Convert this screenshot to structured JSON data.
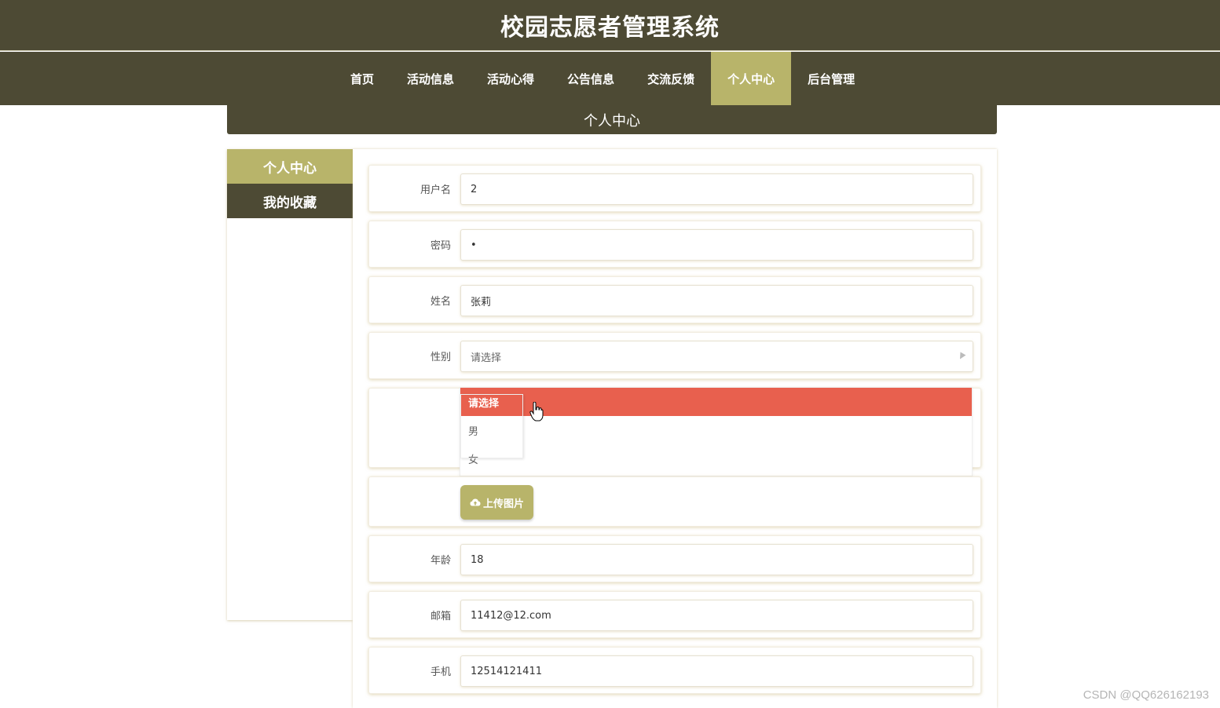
{
  "app": {
    "title": "校园志愿者管理系统"
  },
  "nav": {
    "items": [
      {
        "label": "首页",
        "active": false
      },
      {
        "label": "活动信息",
        "active": false
      },
      {
        "label": "活动心得",
        "active": false
      },
      {
        "label": "公告信息",
        "active": false
      },
      {
        "label": "交流反馈",
        "active": false
      },
      {
        "label": "个人中心",
        "active": true
      },
      {
        "label": "后台管理",
        "active": false
      }
    ]
  },
  "section": {
    "title": "个人中心"
  },
  "sidebar": {
    "items": [
      {
        "label": "个人中心",
        "active": true
      },
      {
        "label": "我的收藏",
        "active": false
      }
    ]
  },
  "form": {
    "username": {
      "label": "用户名",
      "value": "2"
    },
    "password": {
      "label": "密码",
      "value": "•"
    },
    "name": {
      "label": "姓名",
      "value": "张莉"
    },
    "gender": {
      "label": "性别",
      "value": "请选择",
      "options": [
        "请选择",
        "男",
        "女"
      ]
    },
    "upload": {
      "label": "上传图片",
      "icon": "cloud-upload-icon"
    },
    "age": {
      "label": "年龄",
      "value": "18"
    },
    "email": {
      "label": "邮箱",
      "value": "11412@12.com"
    },
    "phone": {
      "label": "手机",
      "value": "12514121411"
    }
  },
  "colors": {
    "header_bg": "#4d4a34",
    "accent": "#b8b46a",
    "dropdown_selected": "#e8604e"
  },
  "watermark": "CSDN @QQ626162193"
}
